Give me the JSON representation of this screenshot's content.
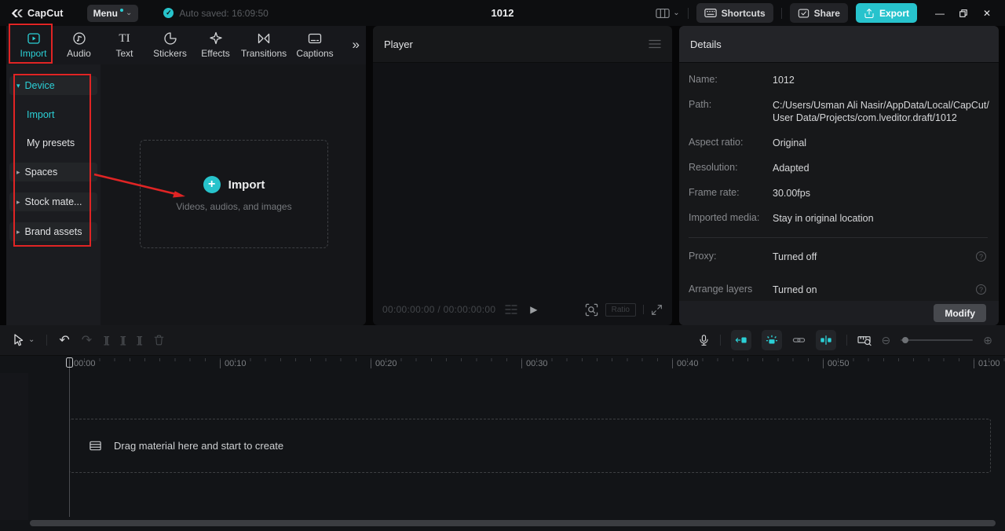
{
  "topbar": {
    "logo_text": "CapCut",
    "menu_label": "Menu",
    "autosave": "Auto saved: 16:09:50",
    "title": "1012",
    "shortcuts_label": "Shortcuts",
    "share_label": "Share",
    "export_label": "Export"
  },
  "media": {
    "tabs": [
      {
        "label": "Import"
      },
      {
        "label": "Audio"
      },
      {
        "label": "Text"
      },
      {
        "label": "Stickers"
      },
      {
        "label": "Effects"
      },
      {
        "label": "Transitions"
      },
      {
        "label": "Captions"
      }
    ],
    "sidebar": {
      "items": [
        {
          "label": "Device",
          "type": "section",
          "state": "expanded",
          "active": true
        },
        {
          "label": "Import",
          "type": "child",
          "active": true
        },
        {
          "label": "My presets",
          "type": "child",
          "active": false
        },
        {
          "label": "Spaces",
          "type": "section",
          "state": "collapsed"
        },
        {
          "label": "Stock mate...",
          "type": "section",
          "state": "collapsed"
        },
        {
          "label": "Brand assets",
          "type": "section",
          "state": "collapsed"
        }
      ]
    },
    "dropzone": {
      "title": "Import",
      "subtitle": "Videos, audios, and images"
    }
  },
  "player": {
    "header": "Player",
    "timecode": "00:00:00:00 / 00:00:00:00",
    "ratio_label": "Ratio"
  },
  "details": {
    "header": "Details",
    "rows": [
      {
        "label": "Name:",
        "value": "1012"
      },
      {
        "label": "Path:",
        "value": "C:/Users/Usman Ali Nasir/AppData/Local/CapCut/User Data/Projects/com.lveditor.draft/1012"
      },
      {
        "label": "Aspect ratio:",
        "value": "Original"
      },
      {
        "label": "Resolution:",
        "value": "Adapted"
      },
      {
        "label": "Frame rate:",
        "value": "30.00fps"
      },
      {
        "label": "Imported media:",
        "value": "Stay in original location"
      },
      {
        "label": "Proxy:",
        "value": "Turned off"
      },
      {
        "label": "Arrange layers",
        "value": "Turned on"
      }
    ],
    "modify_label": "Modify"
  },
  "timeline": {
    "ruler_labels": [
      "00:00",
      "00:10",
      "00:20",
      "00:30",
      "00:40",
      "00:50",
      "01:00"
    ],
    "dropzone_text": "Drag material here and start to create"
  },
  "icons": {
    "check": "✓",
    "menu_caret": "⌄",
    "layout_caret": "⌄",
    "cursor_caret": "⌄",
    "more_tabs": "»",
    "caret_down": "▾",
    "caret_right": "▸",
    "plus": "+",
    "play": "▶",
    "undo": "↶",
    "redo": "↷",
    "split": "][",
    "zoom_out": "⊖",
    "zoom_in": "⊕",
    "minimize": "—",
    "close": "✕",
    "help": "?",
    "text_tab": "TI",
    "divider": "|"
  },
  "colors": {
    "accent": "#2bd0d6",
    "export_bg": "#27c3cd",
    "annotation_red": "#e02424"
  }
}
